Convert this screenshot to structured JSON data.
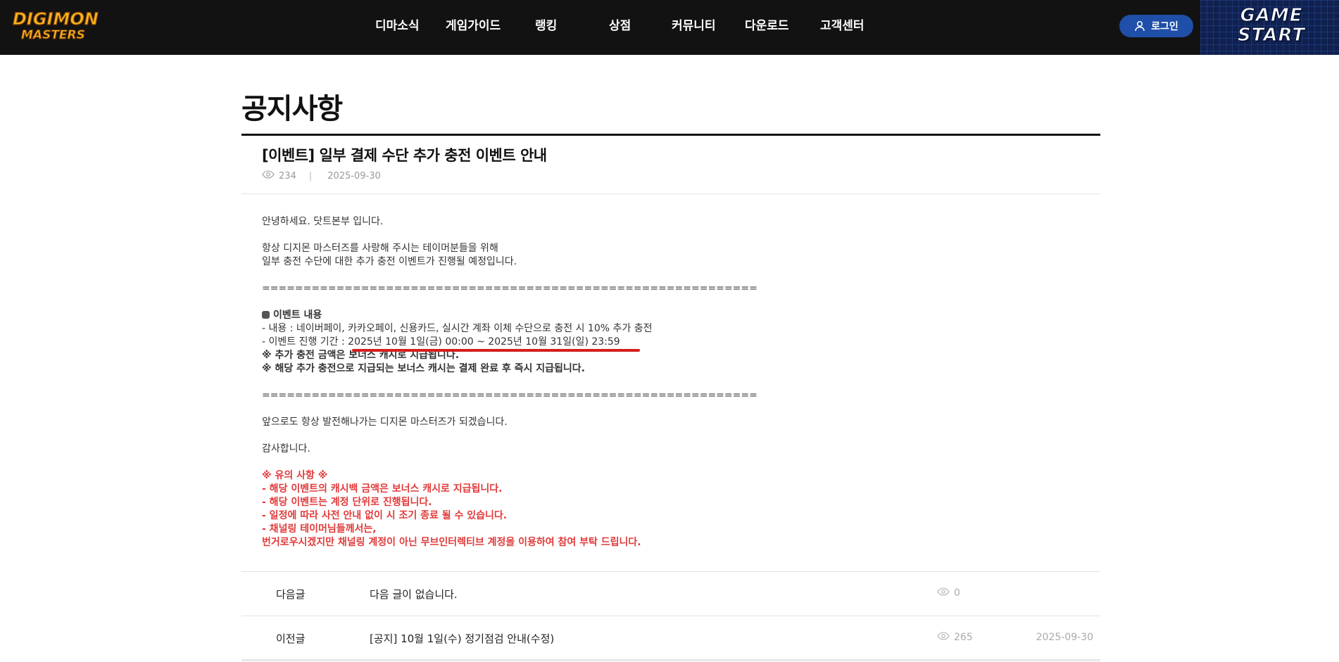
{
  "header": {
    "logo_text": [
      "DIGIMON",
      "MASTERS"
    ],
    "nav": [
      "디마소식",
      "게임가이드",
      "랭킹",
      "상점",
      "커뮤니티",
      "다운로드",
      "고객센터"
    ],
    "login_label": "로그인",
    "game_start_lines": [
      "GAME",
      "START"
    ]
  },
  "page": {
    "title": "공지사항"
  },
  "post": {
    "title": "[이벤트] 일부 결제 수단 추가 충전 이벤트 안내",
    "views": "234",
    "sep": "|",
    "date": "2025-09-30",
    "lines": {
      "greeting": "안녕하세요. 닷트본부 입니다.",
      "intro1": "항상 디지몬 마스터즈를 사랑해 주시는 테이머분들을 위해",
      "intro2": "일부 충전 수단에 대한 추가 충전 이벤트가 진행될 예정입니다.",
      "divider": "============================================================",
      "section_heading": "이벤트 내용",
      "content": " - 내용 : 네이버페이, 카카오페이, 신용카드, 실시간 계좌 이체 수단으로 충전 시 10% 추가 충전",
      "period": " - 이벤트 진행 기간 : 2025년 10월 1일(금) 00:00 ~ 2025년 10월 31일(일) 23:59",
      "note1": " ※ 추가 충전 금액은 보너스 캐시로 지급됩니다.",
      "note2": " ※ 해당 추가 충전으로 지급되는 보너스 캐시는 결제 완료 후 즉시 지급됩니다.",
      "closing": "앞으로도 항상 발전해나가는 디지몬 마스터즈가 되겠습니다.",
      "thanks": "감사합니다.",
      "caution_heading": "※ 유의 사항 ※",
      "caution1": "- 해당 이벤트의 캐시백 금액은 보너스 캐시로 지급됩니다.",
      "caution2": "- 해당 이벤트는 계정 단위로 진행됩니다.",
      "caution3": "- 일정에 따라 사전 안내 없이 시 조기 종료 될 수 있습니다.",
      "caution4": "- 채널링 테이머님들께서는,",
      "caution5": "번거로우시겠지만 채널링 계정이 아닌 무브인터렉티브 계정을 이용하여 참여 부탁 드립니다."
    }
  },
  "navigation": {
    "next": {
      "label": "다음글",
      "title": "다음 글이 없습니다.",
      "views": "0",
      "date": ""
    },
    "prev": {
      "label": "이전글",
      "title": "[공지] 10월 1일(수) 정기점검 안내(수정)",
      "views": "265",
      "date": "2025-09-30"
    }
  },
  "colors": {
    "header_bg": "#121212",
    "login_bg": "#1f4fa8",
    "accent_red": "#e23a3a",
    "underline_red": "#d41f1f"
  },
  "icons": [
    "eye-icon",
    "user-icon"
  ]
}
